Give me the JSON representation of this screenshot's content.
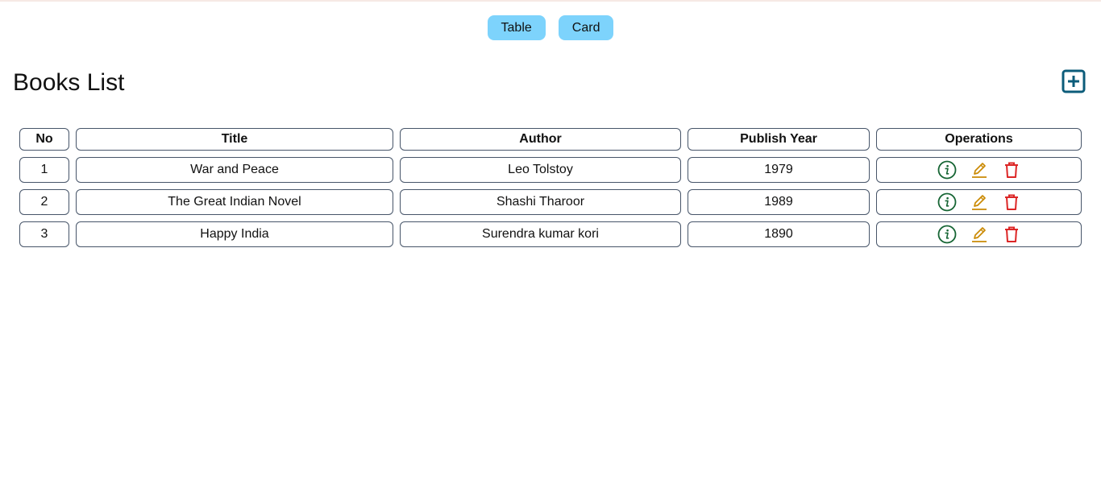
{
  "view_toggle": {
    "table_label": "Table",
    "card_label": "Card"
  },
  "page": {
    "title": "Books List",
    "add_icon": "plus-square-icon"
  },
  "table": {
    "headers": [
      "No",
      "Title",
      "Author",
      "Publish Year",
      "Operations"
    ],
    "rows": [
      {
        "no": "1",
        "title": "War and Peace",
        "author": "Leo Tolstoy",
        "year": "1979"
      },
      {
        "no": "2",
        "title": "The Great Indian Novel",
        "author": "Shashi Tharoor",
        "year": "1989"
      },
      {
        "no": "3",
        "title": "Happy India",
        "author": "Surendra kumar kori",
        "year": "1890"
      }
    ],
    "operation_icons": [
      "info-circle-icon",
      "edit-pencil-icon",
      "trash-icon"
    ]
  },
  "colors": {
    "toggle_bg": "#7dd3fc",
    "add_icon": "#0c5c7a",
    "info_icon": "#166534",
    "edit_icon": "#ca8a04",
    "delete_icon": "#dc2626",
    "cell_border": "#475569"
  }
}
